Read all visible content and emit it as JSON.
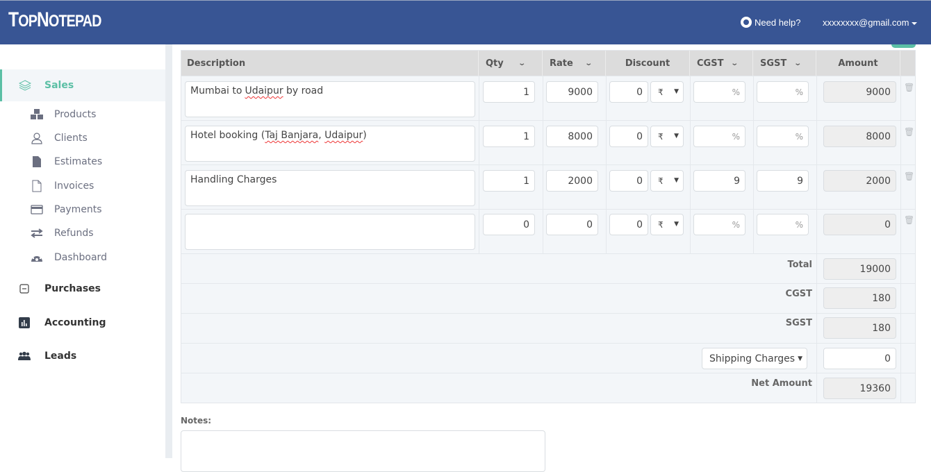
{
  "header": {
    "logo_big1": "T",
    "logo_small1": "OP",
    "logo_big2": "N",
    "logo_small2": "OTEPAD",
    "help_label": "Need help?",
    "user_email": "xxxxxxxx@gmail.com"
  },
  "sidebar": {
    "sales": "Sales",
    "sub_items": [
      {
        "label": "Products",
        "icon": "cubes-icon"
      },
      {
        "label": "Clients",
        "icon": "user-outline-icon"
      },
      {
        "label": "Estimates",
        "icon": "file-icon"
      },
      {
        "label": "Invoices",
        "icon": "file-outline-icon"
      },
      {
        "label": "Payments",
        "icon": "credit-card-icon"
      },
      {
        "label": "Refunds",
        "icon": "exchange-icon"
      },
      {
        "label": "Dashboard",
        "icon": "dashboard-icon"
      }
    ],
    "purchases": "Purchases",
    "accounting": "Accounting",
    "leads": "Leads"
  },
  "table": {
    "headers": {
      "description": "Description",
      "qty": "Qty",
      "rate": "Rate",
      "discount": "Discount",
      "cgst": "CGST",
      "sgst": "SGST",
      "amount": "Amount"
    },
    "currency_symbol": "₹",
    "percent_placeholder": "%",
    "rows": [
      {
        "description_pre": "Mumbai to ",
        "description_err": "Udaipur",
        "description_post": " by road",
        "qty": "1",
        "rate": "9000",
        "discount": "0",
        "cgst": "",
        "sgst": "",
        "amount": "9000"
      },
      {
        "description_pre": "Hotel booking (",
        "description_err": "Taj Banjara",
        "description_mid": ", ",
        "description_err2": "Udaipur",
        "description_post": ")",
        "qty": "1",
        "rate": "8000",
        "discount": "0",
        "cgst": "",
        "sgst": "",
        "amount": "8000"
      },
      {
        "description_pre": "Handling Charges",
        "qty": "1",
        "rate": "2000",
        "discount": "0",
        "cgst": "9",
        "sgst": "9",
        "amount": "2000"
      },
      {
        "description_pre": "",
        "qty": "0",
        "rate": "0",
        "discount": "0",
        "cgst": "",
        "sgst": "",
        "amount": "0"
      }
    ]
  },
  "summary": {
    "total_label": "Total",
    "total": "19000",
    "cgst_label": "CGST",
    "cgst": "180",
    "sgst_label": "SGST",
    "sgst": "180",
    "shipping_select": "Shipping Charges",
    "shipping": "0",
    "net_label": "Net Amount",
    "net": "19360"
  },
  "notes": {
    "label": "Notes:",
    "value": ""
  }
}
